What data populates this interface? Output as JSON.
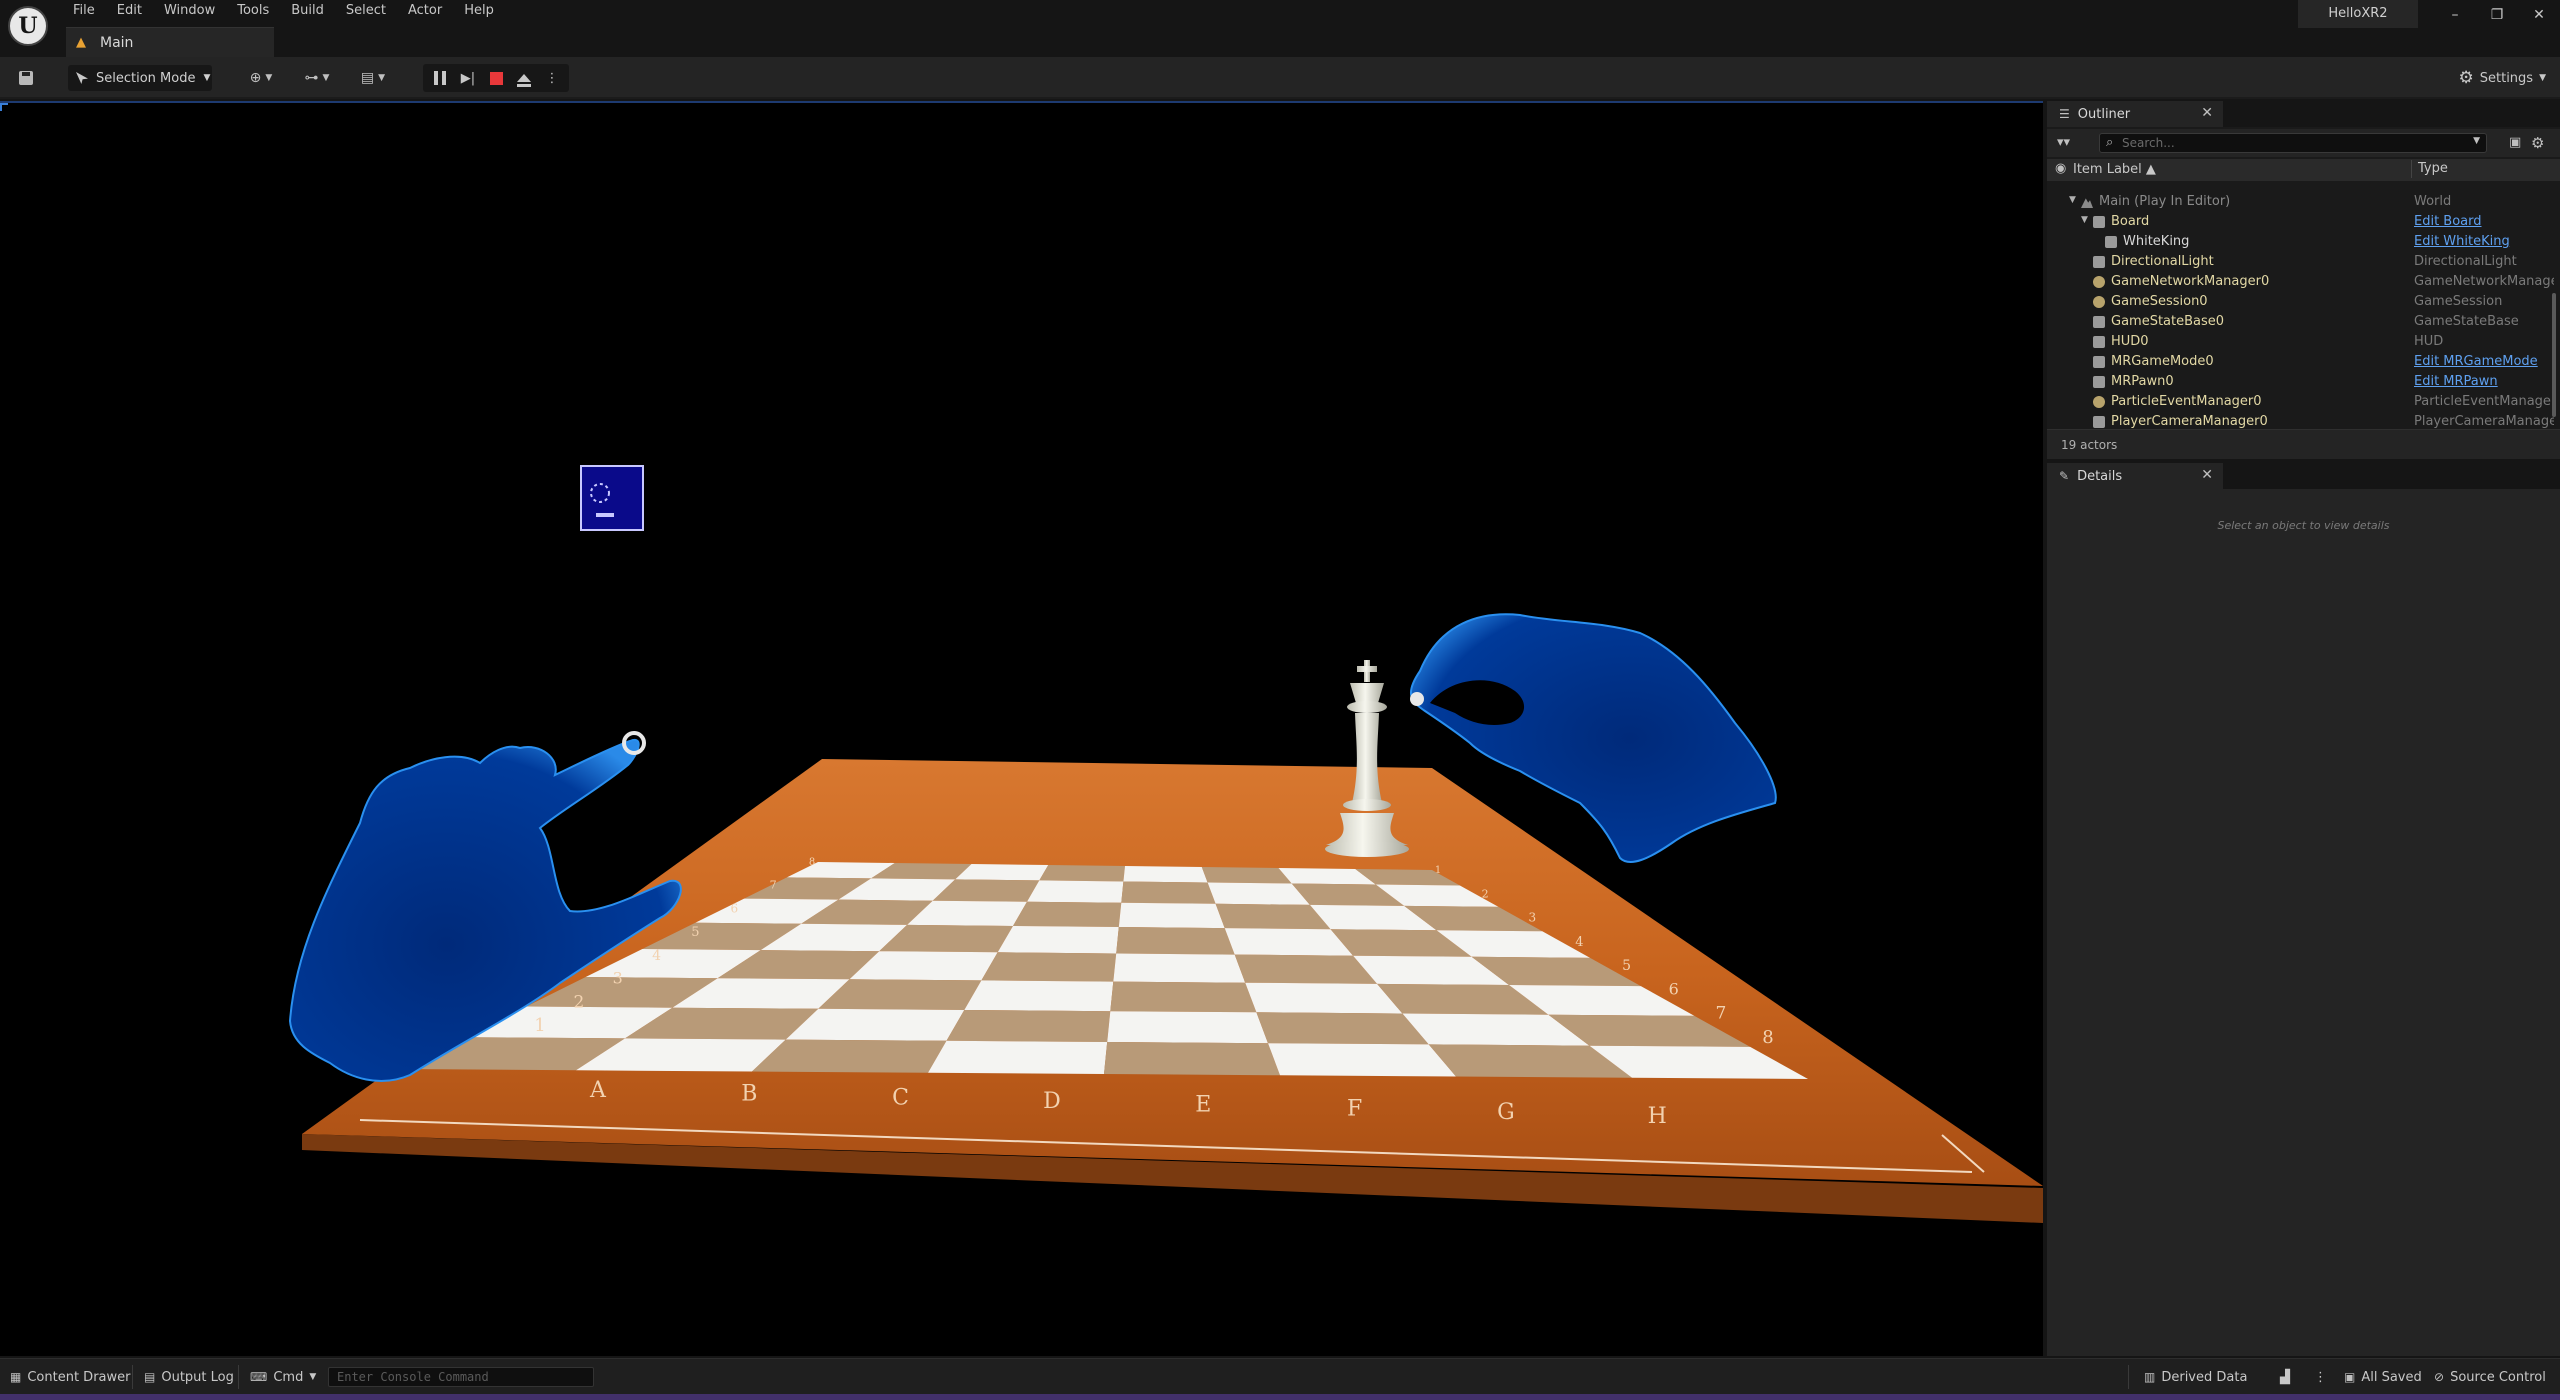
{
  "app": {
    "project_name": "HelloXR2",
    "level_tab": "Main"
  },
  "menu": [
    "File",
    "Edit",
    "Window",
    "Tools",
    "Build",
    "Select",
    "Actor",
    "Help"
  ],
  "window_controls": {
    "minimize": "–",
    "restore": "❐",
    "close": "✕"
  },
  "toolbar": {
    "mode_label": "Selection Mode",
    "settings_label": "Settings"
  },
  "outliner": {
    "tab_title": "Outliner",
    "search_placeholder": "Search...",
    "col_label": "Item Label",
    "col_type": "Type",
    "rows": [
      {
        "name": "Main (Play In Editor)",
        "type": "World",
        "type_link": false
      },
      {
        "name": "Board",
        "type": "Edit Board",
        "type_link": true
      },
      {
        "name": "WhiteKing",
        "type": "Edit WhiteKing",
        "type_link": true
      },
      {
        "name": "DirectionalLight",
        "type": "DirectionalLight",
        "type_link": false
      },
      {
        "name": "GameNetworkManager0",
        "type": "GameNetworkManager",
        "type_link": false
      },
      {
        "name": "GameSession0",
        "type": "GameSession",
        "type_link": false
      },
      {
        "name": "GameStateBase0",
        "type": "GameStateBase",
        "type_link": false
      },
      {
        "name": "HUD0",
        "type": "HUD",
        "type_link": false
      },
      {
        "name": "MRGameMode0",
        "type": "Edit MRGameMode",
        "type_link": true
      },
      {
        "name": "MRPawn0",
        "type": "Edit MRPawn",
        "type_link": true
      },
      {
        "name": "ParticleEventManager0",
        "type": "ParticleEventManager",
        "type_link": false
      },
      {
        "name": "PlayerCameraManager0",
        "type": "PlayerCameraManager",
        "type_link": false
      }
    ],
    "footer": "19 actors"
  },
  "details": {
    "tab_title": "Details",
    "empty_message": "Select an object to view details"
  },
  "statusbar": {
    "content_drawer": "Content Drawer",
    "output_log": "Output Log",
    "cmd": "Cmd",
    "console_placeholder": "Enter Console Command",
    "derived_data": "Derived Data",
    "all_saved": "All Saved",
    "source_control": "Source Control"
  },
  "board": {
    "files": [
      "A",
      "B",
      "C",
      "D",
      "E",
      "F",
      "G",
      "H"
    ],
    "ranks": [
      "1",
      "2",
      "3",
      "4",
      "5",
      "6",
      "7",
      "8"
    ]
  },
  "colors": {
    "accent_blue": "#5ea0f0",
    "actor_name": "#e2d8a5",
    "stop_red": "#e8383a",
    "hand_blue": "#0a3aa0",
    "board_wood": "#c8641e",
    "square_dark": "#b89a78",
    "square_light": "#f4f4f2"
  },
  "icons": {
    "logo": "unreal-logo-icon",
    "level": "level-icon",
    "save": "save-icon",
    "pause": "pause-icon",
    "step": "step-icon",
    "stop": "stop-icon",
    "eject": "eject-icon",
    "settings": "gear-icon",
    "search": "search-icon",
    "filter": "filter-icon"
  }
}
